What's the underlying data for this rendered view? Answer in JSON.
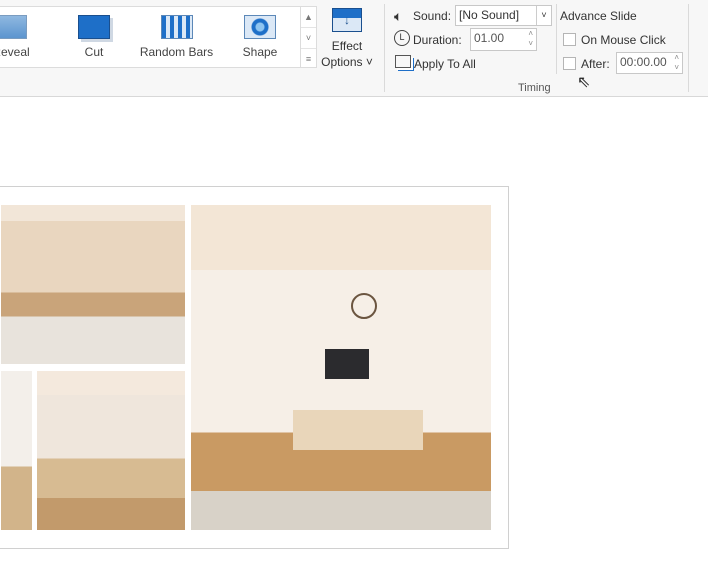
{
  "gallery": {
    "items": [
      {
        "label": "Reveal",
        "icon": "reveal-icon"
      },
      {
        "label": "Cut",
        "icon": "cut-icon"
      },
      {
        "label": "Random Bars",
        "icon": "random-bars-icon"
      },
      {
        "label": "Shape",
        "icon": "shape-icon"
      }
    ]
  },
  "effect_options": {
    "line1": "Effect",
    "line2": "Options ˅"
  },
  "timing": {
    "sound_label": "Sound:",
    "sound_value": "[No Sound]",
    "duration_label": "Duration:",
    "duration_value": "01.00",
    "apply_all": "Apply To All",
    "group_label": "Timing"
  },
  "advance": {
    "title": "Advance Slide",
    "on_click": "On Mouse Click",
    "on_click_checked": false,
    "after_label": "After:",
    "after_value": "00:00.00",
    "after_checked": false
  },
  "colors": {
    "accent": "#1e6fc8"
  }
}
